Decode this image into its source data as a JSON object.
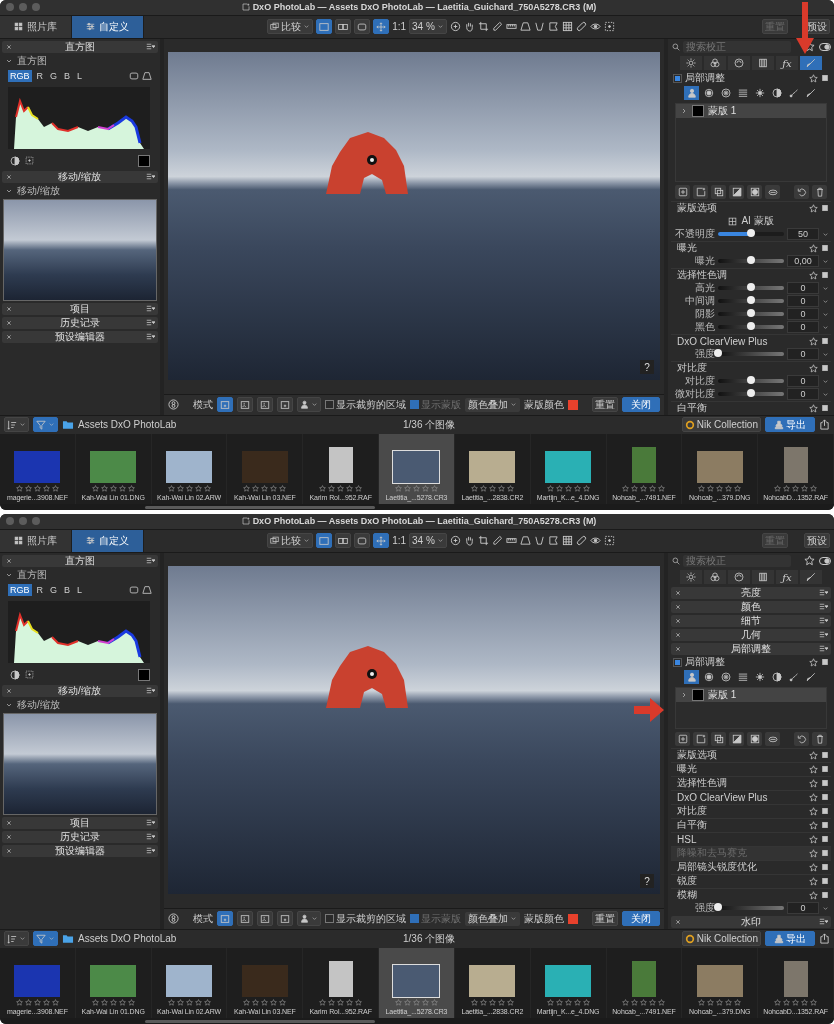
{
  "windows": [
    {
      "title": "DxO PhotoLab — Assets DxO PhotoLab — Laetitia_Guichard_750A5278.CR3 (M)",
      "annotation_arrow": {
        "kind": "down"
      },
      "tabs": [
        {
          "label": "照片库",
          "selected": false
        },
        {
          "label": "自定义",
          "selected": true
        }
      ],
      "toolbar": {
        "compare": "比较",
        "view_modes": [
          {
            "selected": true
          },
          {
            "selected": false
          }
        ],
        "move_selected": true,
        "one_to_one": "1:1",
        "zoom": "34 %",
        "buttons": [
          {
            "label": "重置",
            "disabled": true
          },
          {
            "label": "预设",
            "disabled": false
          }
        ]
      },
      "left_panel": {
        "palettes": [
          {
            "kind": "histogram",
            "title": "直方图",
            "sub": "直方图",
            "channels": [
              {
                "label": "RGB",
                "selected": true
              },
              {
                "label": "R",
                "selected": false
              },
              {
                "label": "G",
                "selected": false
              },
              {
                "label": "B",
                "selected": false
              },
              {
                "label": "L",
                "selected": false
              }
            ]
          },
          {
            "kind": "navigator",
            "title": "移动/缩放",
            "sub": "移动/缩放"
          },
          {
            "kind": "collapsed",
            "title": "项目"
          },
          {
            "kind": "collapsed",
            "title": "历史记录"
          },
          {
            "kind": "collapsed",
            "title": "预设编辑器"
          }
        ]
      },
      "viewer": {
        "help": "?"
      },
      "right_panel": {
        "search_placeholder": "搜索校正",
        "palette_tabs": [
          {
            "selected": false
          },
          {
            "selected": false
          },
          {
            "selected": false
          },
          {
            "selected": false
          },
          {
            "selected": false,
            "label": "ƒx"
          },
          {
            "selected": true
          }
        ],
        "sections": [
          {
            "kind": "local",
            "title": "局部调整",
            "enabled": true,
            "tools": [
              {
                "selected": true
              },
              {
                "selected": false
              },
              {
                "selected": false
              },
              {
                "selected": false
              },
              {
                "selected": false
              },
              {
                "selected": false
              },
              {
                "selected": false
              },
              {
                "selected": false
              }
            ],
            "masks": [
              {
                "label": "蒙版 1",
                "selected": true
              }
            ]
          },
          {
            "kind": "group",
            "title": "蒙版选项",
            "disabled": false,
            "rows": [
              {
                "kind": "option",
                "label": "AI 蒙版"
              },
              {
                "kind": "fill_slider",
                "label": "不透明度",
                "level": 0.5,
                "value": "50"
              }
            ]
          },
          {
            "kind": "group",
            "title": "曝光",
            "disabled": false,
            "rows": [
              {
                "kind": "slider",
                "label": "曝光",
                "level": 0.5,
                "value": "0,00"
              }
            ]
          },
          {
            "kind": "group",
            "title": "选择性色调",
            "disabled": false,
            "rows": [
              {
                "kind": "slider",
                "label": "高光",
                "level": 0.5,
                "value": "0"
              },
              {
                "kind": "slider",
                "label": "中间调",
                "level": 0.5,
                "value": "0"
              },
              {
                "kind": "slider",
                "label": "阴影",
                "level": 0.5,
                "value": "0"
              },
              {
                "kind": "slider",
                "label": "黑色",
                "level": 0.5,
                "value": "0"
              }
            ]
          },
          {
            "kind": "group",
            "title": "DxO ClearView Plus",
            "disabled": false,
            "rows": [
              {
                "kind": "slider",
                "label": "强度",
                "level": 0,
                "value": "0"
              }
            ]
          },
          {
            "kind": "group",
            "title": "对比度",
            "disabled": false,
            "rows": [
              {
                "kind": "slider",
                "label": "对比度",
                "level": 0.5,
                "value": "0"
              },
              {
                "kind": "slider",
                "label": "微对比度",
                "level": 0.5,
                "value": "0"
              }
            ]
          },
          {
            "kind": "group",
            "title": "白平衡",
            "disabled": false
          }
        ]
      },
      "control_bar": {
        "mode_label": "模式",
        "mode_buttons": [
          {
            "selected": true
          },
          {
            "selected": false
          }
        ],
        "checkboxes": [
          {
            "label": "显示裁剪的区域",
            "checked": false,
            "disabled": false
          },
          {
            "label": "显示蒙版",
            "checked": true,
            "disabled": true
          }
        ],
        "overlay_select": "颜色叠加",
        "mask_color_label": "蒙版颜色",
        "mask_swatch": {
          "color": "#e8412c"
        },
        "buttons": [
          {
            "label": "重置",
            "kind": "normal"
          },
          {
            "label": "关闭",
            "kind": "primary"
          }
        ]
      },
      "filmstrip": {
        "folder": "Assets DxO PhotoLab",
        "count": "1/36 个图像",
        "nik": "Nik Collection",
        "export": "导出",
        "thumbs": [
          {
            "name": "magerie...3908.NEF",
            "stars": 0,
            "selected": false
          },
          {
            "name": "Kah-Wai Lin 01.DNG",
            "stars": 0,
            "selected": false
          },
          {
            "name": "Kah-Wai Lin 02.ARW",
            "stars": 0,
            "selected": false
          },
          {
            "name": "Kah-Wai Lin 03.NEF",
            "stars": 0,
            "selected": false
          },
          {
            "name": "Karim Rol...952.RAF",
            "stars": 0,
            "selected": false
          },
          {
            "name": "Laetitia_...5278.CR3",
            "stars": 0,
            "selected": true
          },
          {
            "name": "Laetitia_...2838.CR2",
            "stars": 0,
            "selected": false
          },
          {
            "name": "Martijn_K...e_4.DNG",
            "stars": 0,
            "selected": false
          },
          {
            "name": "Nohcab_...7491.NEF",
            "stars": 0,
            "selected": false
          },
          {
            "name": "Nohcab_...379.DNG",
            "stars": 0,
            "selected": false
          },
          {
            "name": "NohcabD...1352.RAF",
            "stars": 0,
            "selected": false
          }
        ]
      }
    },
    {
      "title": "DxO PhotoLab — Assets DxO PhotoLab — Laetitia_Guichard_750A5278.CR3 (M)",
      "annotation_arrow": {
        "kind": "right"
      },
      "tabs": [
        {
          "label": "照片库",
          "selected": false
        },
        {
          "label": "自定义",
          "selected": true
        }
      ],
      "toolbar": {
        "compare": "比较",
        "view_modes": [
          {
            "selected": true
          },
          {
            "selected": false
          }
        ],
        "move_selected": true,
        "one_to_one": "1:1",
        "zoom": "34 %",
        "buttons": [
          {
            "label": "重置",
            "disabled": true
          },
          {
            "label": "预设",
            "disabled": false
          }
        ]
      },
      "left_panel": {
        "palettes": [
          {
            "kind": "histogram",
            "title": "直方图",
            "sub": "直方图",
            "channels": [
              {
                "label": "RGB",
                "selected": true
              },
              {
                "label": "R",
                "selected": false
              },
              {
                "label": "G",
                "selected": false
              },
              {
                "label": "B",
                "selected": false
              },
              {
                "label": "L",
                "selected": false
              }
            ]
          },
          {
            "kind": "navigator",
            "title": "移动/缩放",
            "sub": "移动/缩放"
          },
          {
            "kind": "collapsed",
            "title": "项目"
          },
          {
            "kind": "collapsed",
            "title": "历史记录"
          },
          {
            "kind": "collapsed",
            "title": "预设编辑器"
          }
        ]
      },
      "viewer": {
        "help": "?"
      },
      "right_panel": {
        "search_placeholder": "搜索校正",
        "palette_tabs": [
          {
            "selected": false
          },
          {
            "selected": false
          },
          {
            "selected": false
          },
          {
            "selected": false
          },
          {
            "selected": false,
            "label": "ƒx"
          },
          {
            "selected": false
          }
        ],
        "sections": [
          {
            "kind": "palette",
            "title": "亮度"
          },
          {
            "kind": "palette",
            "title": "颜色"
          },
          {
            "kind": "palette",
            "title": "细节"
          },
          {
            "kind": "palette",
            "title": "几何"
          },
          {
            "kind": "palette",
            "title": "局部调整"
          },
          {
            "kind": "local",
            "title": "局部调整",
            "enabled": true,
            "tools": [
              {
                "selected": true
              },
              {
                "selected": false
              },
              {
                "selected": false
              },
              {
                "selected": false
              },
              {
                "selected": false
              },
              {
                "selected": false
              },
              {
                "selected": false
              },
              {
                "selected": false
              }
            ],
            "masks": [
              {
                "label": "蒙版 1",
                "selected": true
              }
            ]
          },
          {
            "kind": "group",
            "title": "蒙版选项",
            "disabled": false
          },
          {
            "kind": "group",
            "title": "曝光",
            "disabled": false
          },
          {
            "kind": "group",
            "title": "选择性色调",
            "disabled": false
          },
          {
            "kind": "group",
            "title": "DxO ClearView Plus",
            "disabled": false
          },
          {
            "kind": "group",
            "title": "对比度",
            "disabled": false
          },
          {
            "kind": "group",
            "title": "白平衡",
            "disabled": false
          },
          {
            "kind": "group",
            "title": "HSL",
            "disabled": false
          },
          {
            "kind": "group",
            "title": "降噪和去马赛克",
            "disabled": true
          },
          {
            "kind": "group",
            "title": "局部镜头锐度优化",
            "disabled": false
          },
          {
            "kind": "group",
            "title": "锐度",
            "disabled": false
          },
          {
            "kind": "group",
            "title": "模糊",
            "disabled": false,
            "rows": [
              {
                "kind": "slider",
                "label": "强度",
                "level": 0,
                "value": "0"
              }
            ]
          },
          {
            "kind": "palette",
            "title": "水印"
          }
        ]
      },
      "control_bar": {
        "mode_label": "模式",
        "mode_buttons": [
          {
            "selected": true
          },
          {
            "selected": false
          }
        ],
        "checkboxes": [
          {
            "label": "显示裁剪的区域",
            "checked": false,
            "disabled": false
          },
          {
            "label": "显示蒙版",
            "checked": true,
            "disabled": true
          }
        ],
        "overlay_select": "颜色叠加",
        "mask_color_label": "蒙版颜色",
        "mask_swatch": {
          "color": "#e8412c"
        },
        "buttons": [
          {
            "label": "重置",
            "kind": "normal"
          },
          {
            "label": "关闭",
            "kind": "primary"
          }
        ]
      },
      "filmstrip": {
        "folder": "Assets DxO PhotoLab",
        "count": "1/36 个图像",
        "nik": "Nik Collection",
        "export": "导出",
        "thumbs": [
          {
            "name": "magerie...3908.NEF",
            "stars": 0,
            "selected": false
          },
          {
            "name": "Kah-Wai Lin 01.DNG",
            "stars": 0,
            "selected": false
          },
          {
            "name": "Kah-Wai Lin 02.ARW",
            "stars": 0,
            "selected": false
          },
          {
            "name": "Kah-Wai Lin 03.NEF",
            "stars": 0,
            "selected": false
          },
          {
            "name": "Karim Rol...952.RAF",
            "stars": 0,
            "selected": false
          },
          {
            "name": "Laetitia_...5278.CR3",
            "stars": 0,
            "selected": true
          },
          {
            "name": "Laetitia_...2838.CR2",
            "stars": 0,
            "selected": false
          },
          {
            "name": "Martijn_K...e_4.DNG",
            "stars": 0,
            "selected": false
          },
          {
            "name": "Nohcab_...7491.NEF",
            "stars": 0,
            "selected": false
          },
          {
            "name": "Nohcab_...379.DNG",
            "stars": 0,
            "selected": false
          },
          {
            "name": "NohcabD...1352.RAF",
            "stars": 0,
            "selected": false
          }
        ]
      }
    }
  ]
}
